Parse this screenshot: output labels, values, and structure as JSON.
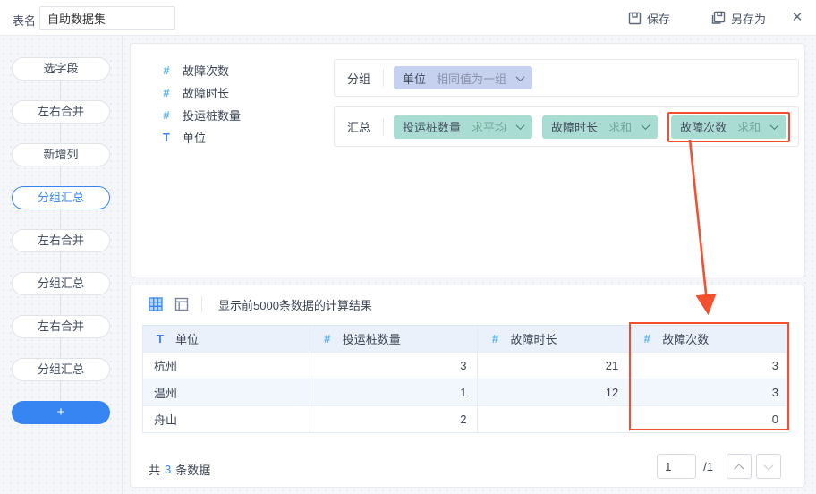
{
  "topbar": {
    "table_name_label": "表名",
    "table_name_value": "自助数据集",
    "save_label": "保存",
    "save_as_label": "另存为",
    "close_icon": "✕"
  },
  "sidebar": {
    "steps": [
      {
        "label": "选字段",
        "active": false
      },
      {
        "label": "左右合并",
        "active": false
      },
      {
        "label": "新增列",
        "active": false
      },
      {
        "label": "分组汇总",
        "active": true
      },
      {
        "label": "左右合并",
        "active": false
      },
      {
        "label": "分组汇总",
        "active": false
      },
      {
        "label": "左右合并",
        "active": false
      },
      {
        "label": "分组汇总",
        "active": false
      }
    ],
    "add_label": "+"
  },
  "fields": [
    {
      "icon": "#",
      "type": "number",
      "name": "故障次数"
    },
    {
      "icon": "#",
      "type": "number",
      "name": "故障时长"
    },
    {
      "icon": "#",
      "type": "number",
      "name": "投运桩数量"
    },
    {
      "icon": "T",
      "type": "text",
      "name": "单位"
    }
  ],
  "group_section": {
    "label": "分组",
    "chip": {
      "field": "单位",
      "rule": "相同值为一组"
    }
  },
  "summary_section": {
    "label": "汇总",
    "chips": [
      {
        "field": "投运桩数量",
        "agg": "求平均",
        "highlight": false
      },
      {
        "field": "故障时长",
        "agg": "求和",
        "highlight": false
      },
      {
        "field": "故障次数",
        "agg": "求和",
        "highlight": true
      }
    ]
  },
  "preview": {
    "notice": "显示前5000条数据的计算结果",
    "table": {
      "columns": [
        {
          "icon": "T",
          "type": "text",
          "name": "单位"
        },
        {
          "icon": "#",
          "type": "number",
          "name": "投运桩数量"
        },
        {
          "icon": "#",
          "type": "number",
          "name": "故障时长"
        },
        {
          "icon": "#",
          "type": "number",
          "name": "故障次数",
          "highlight": true
        }
      ],
      "rows": [
        [
          "杭州",
          "3",
          "21",
          "3"
        ],
        [
          "温州",
          "1",
          "12",
          "3"
        ],
        [
          "舟山",
          "2",
          "",
          "0"
        ]
      ]
    },
    "footer": {
      "total_prefix": "共",
      "total_count": "3",
      "total_suffix": "条数据",
      "page_value": "1",
      "page_total": "/1"
    }
  },
  "colors": {
    "accent_blue": "#3685f2",
    "group_chip_bg": "#c6d1f0",
    "summary_chip_bg": "#a9dcd2",
    "highlight_red": "#f4502f",
    "table_header_bg": "#eaf1fb"
  }
}
